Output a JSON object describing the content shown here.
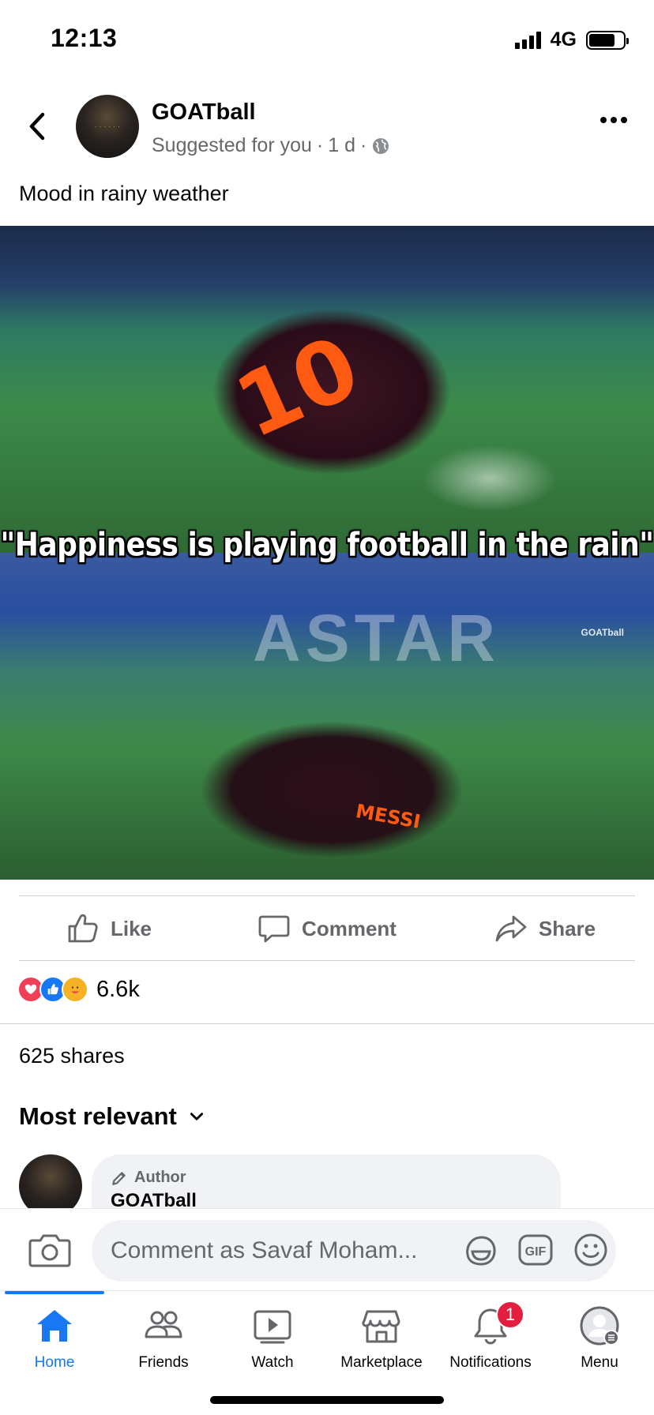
{
  "status_bar": {
    "time": "12:13",
    "network": "4G",
    "battery_level": 0.75
  },
  "post": {
    "author": "GOATball",
    "meta_suggested": "Suggested for you",
    "meta_dot": "·",
    "meta_time": "1 d",
    "text": "Mood in rainy weather",
    "image_caption": "\"Happiness is playing football in the rain\"",
    "image_watermark": "GOATball",
    "stadium_text": "ASTAR",
    "jersey_number": "10",
    "jersey_name": "MESSI"
  },
  "actions": {
    "like": "Like",
    "comment": "Comment",
    "share": "Share"
  },
  "reactions": {
    "count": "6.6k",
    "types": [
      "love",
      "like",
      "care"
    ]
  },
  "shares_text": "625 shares",
  "comments": {
    "sort_label": "Most relevant",
    "first": {
      "badge": "Author",
      "author": "GOATball"
    }
  },
  "composer": {
    "placeholder": "Comment as Savaf Moham..."
  },
  "tab_bar": {
    "tabs": [
      {
        "label": "Home",
        "icon": "home-icon",
        "active": true
      },
      {
        "label": "Friends",
        "icon": "friends-icon"
      },
      {
        "label": "Watch",
        "icon": "watch-icon"
      },
      {
        "label": "Marketplace",
        "icon": "marketplace-icon"
      },
      {
        "label": "Notifications",
        "icon": "bell-icon",
        "badge": "1"
      },
      {
        "label": "Menu",
        "icon": "profile-menu-icon"
      }
    ]
  },
  "colors": {
    "accent": "#1877f2",
    "secondary_text": "#65676b",
    "badge": "#e41e3f"
  }
}
